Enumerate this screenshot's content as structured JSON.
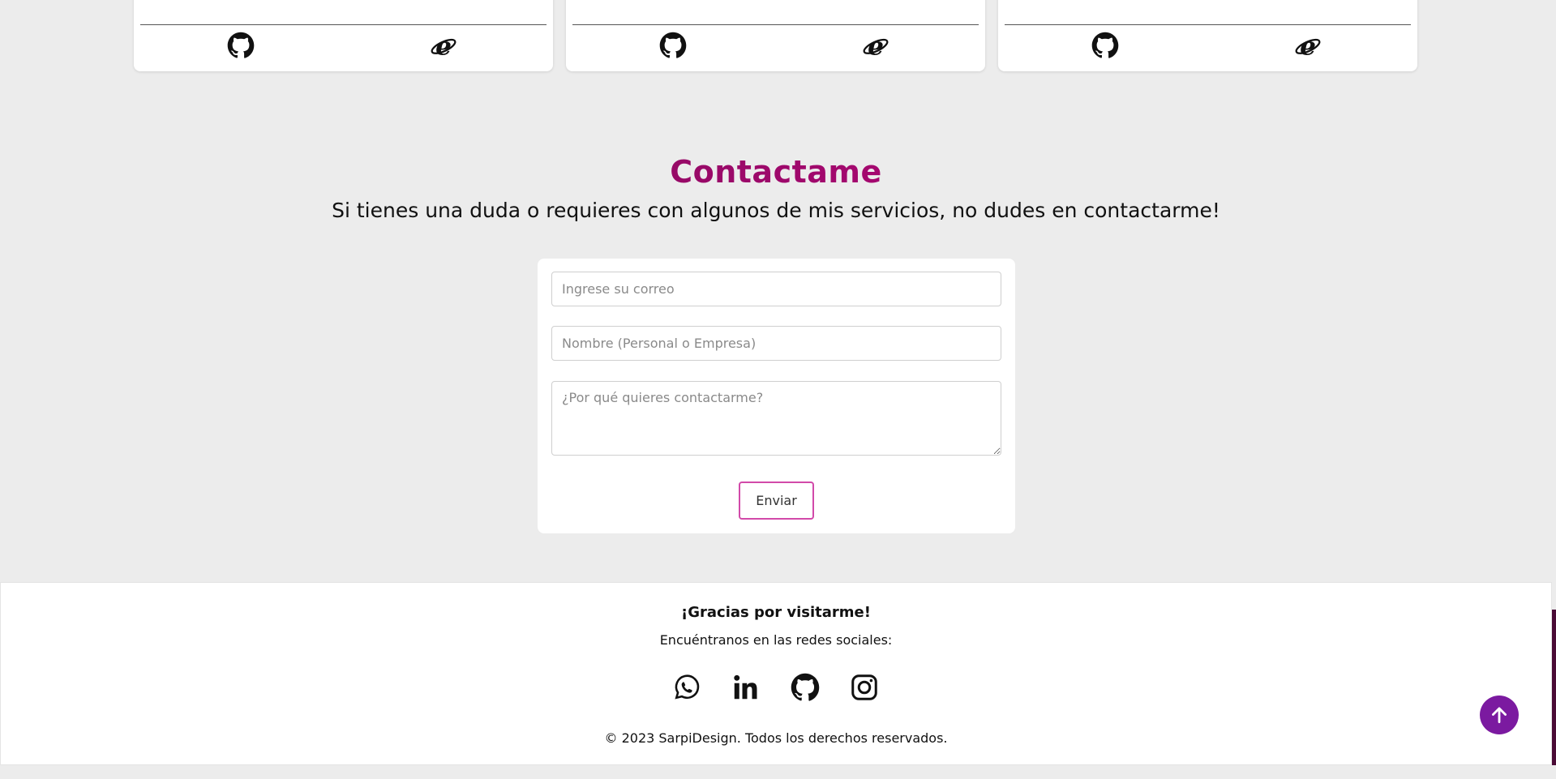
{
  "projects": {
    "cards": [
      {
        "partial_text": "",
        "links": [
          {
            "icon": "github-icon"
          },
          {
            "icon": "internet-explorer-icon"
          }
        ]
      },
      {
        "partial_text": "",
        "links": [
          {
            "icon": "github-icon"
          },
          {
            "icon": "internet-explorer-icon"
          }
        ]
      },
      {
        "partial_text": "",
        "links": [
          {
            "icon": "github-icon"
          },
          {
            "icon": "internet-explorer-icon"
          }
        ]
      }
    ]
  },
  "contact": {
    "title": "Contactame",
    "subtitle": "Si tienes una duda o requieres con algunos de mis servicios, no dudes en contactarme!",
    "email_placeholder": "Ingrese su correo",
    "email_value": "",
    "name_placeholder": "Nombre (Personal o Empresa)",
    "name_value": "",
    "message_placeholder": "¿Por qué quieres contactarme?",
    "message_value": "",
    "submit_label": "Enviar",
    "accent_color": "#c2158a"
  },
  "footer": {
    "thanks": "¡Gracias por visitarme!",
    "social_text": "Encuéntranos en las redes sociales:",
    "social": [
      {
        "icon": "whatsapp-icon"
      },
      {
        "icon": "linkedin-icon"
      },
      {
        "icon": "github-icon"
      },
      {
        "icon": "instagram-icon"
      }
    ],
    "copyright": "© 2023 SarpiDesign. Todos los derechos reservados."
  },
  "scroll_top": {
    "icon": "arrow-up-icon",
    "color": "#7b1aa0"
  }
}
